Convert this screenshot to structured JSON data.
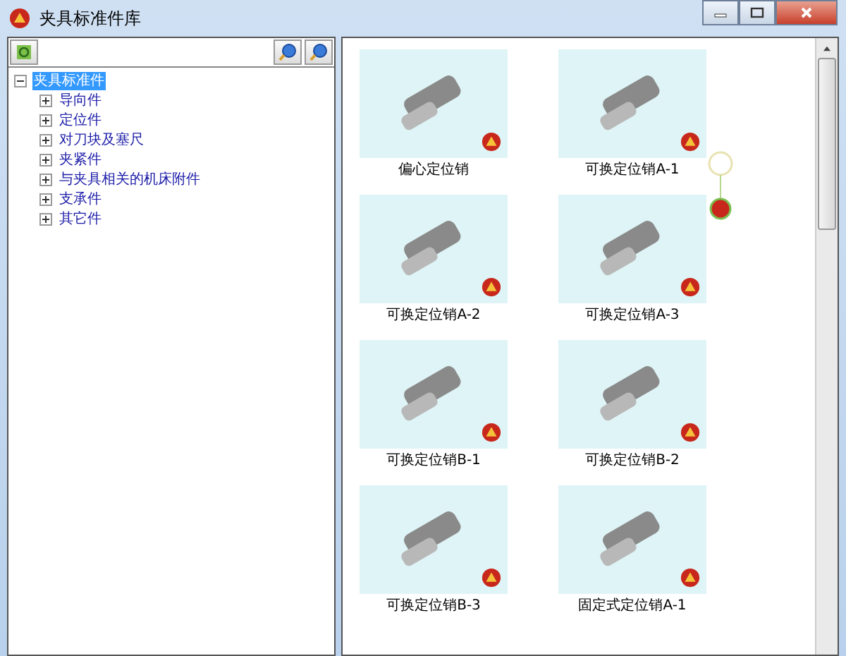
{
  "window": {
    "title": "夹具标准件库"
  },
  "tree": [
    {
      "label": "夹具标准件",
      "expanded": true,
      "selected": true,
      "children": [
        {
          "label": "导向件",
          "expanded": false,
          "selected": false
        },
        {
          "label": "定位件",
          "expanded": false,
          "selected": false
        },
        {
          "label": "对刀块及塞尺",
          "expanded": false,
          "selected": false
        },
        {
          "label": "夹紧件",
          "expanded": false,
          "selected": false
        },
        {
          "label": "与夹具相关的机床附件",
          "expanded": false,
          "selected": false
        },
        {
          "label": "支承件",
          "expanded": false,
          "selected": false
        },
        {
          "label": "其它件",
          "expanded": false,
          "selected": false
        }
      ]
    }
  ],
  "parts": [
    {
      "label": "偏心定位销"
    },
    {
      "label": "可换定位销A-1"
    },
    {
      "label": "可换定位销A-2"
    },
    {
      "label": "可换定位销A-3"
    },
    {
      "label": "可换定位销B-1"
    },
    {
      "label": "可换定位销B-2"
    },
    {
      "label": "可换定位销B-3"
    },
    {
      "label": "固定式定位销A-1"
    }
  ]
}
